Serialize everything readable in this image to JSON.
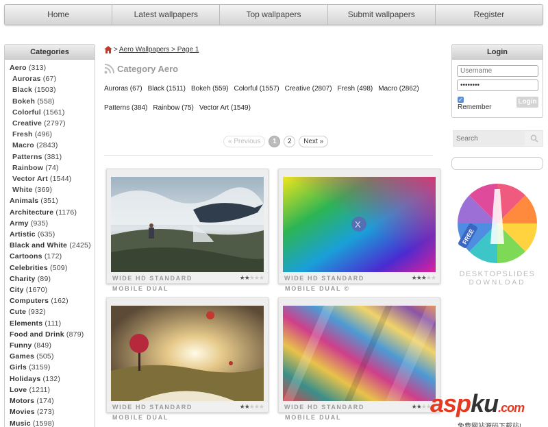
{
  "nav": {
    "items": [
      "Home",
      "Latest wallpapers",
      "Top wallpapers",
      "Submit wallpapers",
      "Register"
    ]
  },
  "sidebar": {
    "title": "Categories",
    "items": [
      {
        "name": "Aero",
        "count": "(313)",
        "sub": false
      },
      {
        "name": "Auroras",
        "count": "(67)",
        "sub": true
      },
      {
        "name": "Black",
        "count": "(1503)",
        "sub": true
      },
      {
        "name": "Bokeh",
        "count": "(558)",
        "sub": true
      },
      {
        "name": "Colorful",
        "count": "(1561)",
        "sub": true
      },
      {
        "name": "Creative",
        "count": "(2797)",
        "sub": true
      },
      {
        "name": "Fresh",
        "count": "(496)",
        "sub": true
      },
      {
        "name": "Macro",
        "count": "(2843)",
        "sub": true
      },
      {
        "name": "Patterns",
        "count": "(381)",
        "sub": true
      },
      {
        "name": "Rainbow",
        "count": "(74)",
        "sub": true
      },
      {
        "name": "Vector Art",
        "count": "(1544)",
        "sub": true
      },
      {
        "name": "White",
        "count": "(369)",
        "sub": true
      },
      {
        "name": "Animals",
        "count": "(351)",
        "sub": false
      },
      {
        "name": "Architecture",
        "count": "(1176)",
        "sub": false
      },
      {
        "name": "Army",
        "count": "(935)",
        "sub": false
      },
      {
        "name": "Artistic",
        "count": "(635)",
        "sub": false
      },
      {
        "name": "Black and White",
        "count": "(2425)",
        "sub": false
      },
      {
        "name": "Cartoons",
        "count": "(172)",
        "sub": false
      },
      {
        "name": "Celebrities",
        "count": "(509)",
        "sub": false
      },
      {
        "name": "Charity",
        "count": "(89)",
        "sub": false
      },
      {
        "name": "City",
        "count": "(1670)",
        "sub": false
      },
      {
        "name": "Computers",
        "count": "(162)",
        "sub": false
      },
      {
        "name": "Cute",
        "count": "(932)",
        "sub": false
      },
      {
        "name": "Elements",
        "count": "(111)",
        "sub": false
      },
      {
        "name": "Food and Drink",
        "count": "(879)",
        "sub": false
      },
      {
        "name": "Funny",
        "count": "(849)",
        "sub": false
      },
      {
        "name": "Games",
        "count": "(505)",
        "sub": false
      },
      {
        "name": "Girls",
        "count": "(3159)",
        "sub": false
      },
      {
        "name": "Holidays",
        "count": "(132)",
        "sub": false
      },
      {
        "name": "Love",
        "count": "(1211)",
        "sub": false
      },
      {
        "name": "Motors",
        "count": "(174)",
        "sub": false
      },
      {
        "name": "Movies",
        "count": "(273)",
        "sub": false
      },
      {
        "name": "Music",
        "count": "(1598)",
        "sub": false
      }
    ]
  },
  "breadcrumb": {
    "sep": ">",
    "text": "Aero Wallpapers > Page 1"
  },
  "category_title": "Category Aero",
  "subcategories": [
    "Auroras (67)",
    "Black (1511)",
    "Bokeh (559)",
    "Colorful (1557)",
    "Creative (2807)",
    "Fresh (498)",
    "Macro (2862)",
    "Patterns (384)",
    "Rainbow (75)",
    "Vector Art (1549)"
  ],
  "pager": {
    "prev": "« Previous",
    "pages": [
      "1",
      "2"
    ],
    "next": "Next »"
  },
  "thumbs": [
    {
      "label": "WIDE HD STANDARD",
      "sub": "MOBILE DUAL",
      "rating": 2
    },
    {
      "label": "WIDE HD STANDARD",
      "sub": "MOBILE DUAL ©",
      "rating": 3
    },
    {
      "label": "WIDE HD STANDARD",
      "sub": "MOBILE DUAL",
      "rating": 2
    },
    {
      "label": "WIDE HD STANDARD",
      "sub": "MOBILE DUAL",
      "rating": 2
    }
  ],
  "login": {
    "title": "Login",
    "username_placeholder": "Username",
    "password_value": "••••••••",
    "remember": "Remember",
    "button": "Login"
  },
  "search": {
    "placeholder": "Search"
  },
  "ad": {
    "badge": "FREE",
    "line1": "DESKTOPSLIDES",
    "line2": "DOWNLOAD"
  },
  "watermark": {
    "asp": "asp",
    "ku": "ku",
    "com": ".com",
    "sub": "免费网站源码下载站!"
  }
}
